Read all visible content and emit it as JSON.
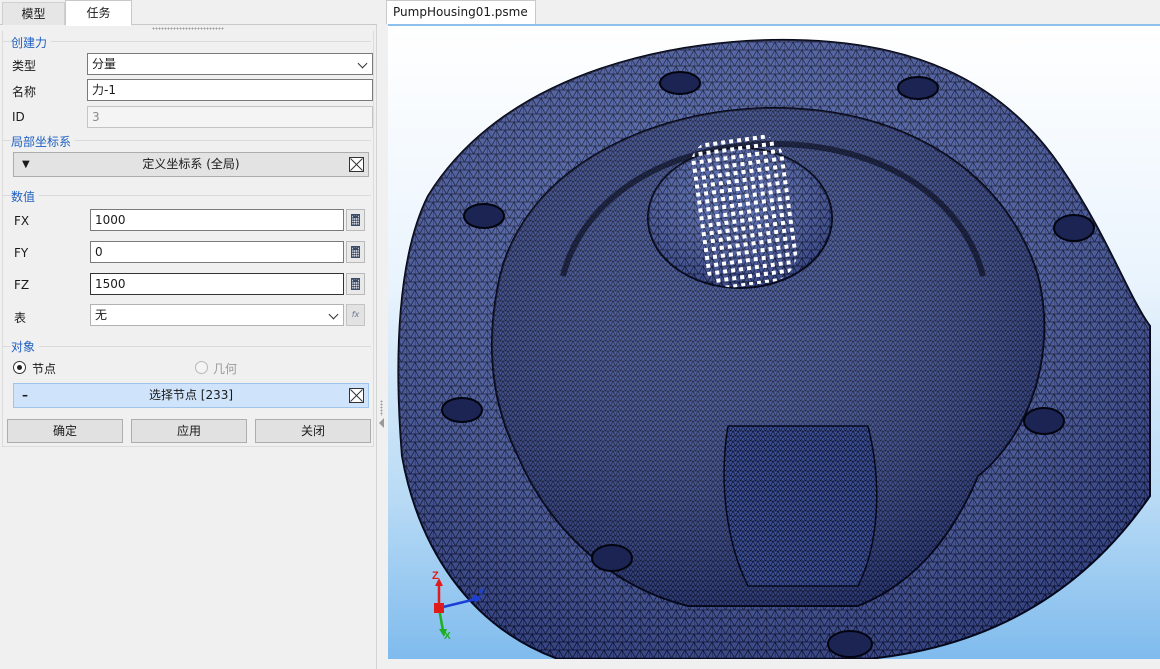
{
  "left_panel": {
    "tabs": [
      {
        "label": "模型",
        "active": false
      },
      {
        "label": "任务",
        "active": true
      }
    ],
    "create_force": {
      "title": "创建力",
      "type_label": "类型",
      "type_value": "分量",
      "name_label": "名称",
      "name_value": "力-1",
      "id_label": "ID",
      "id_value": "3"
    },
    "local_csys": {
      "title": "局部坐标系",
      "bar_label": "定义坐标系 (全局)"
    },
    "values": {
      "title": "数值",
      "fx_label": "FX",
      "fx_value": "1000",
      "fy_label": "FY",
      "fy_value": "0",
      "fz_label": "FZ",
      "fz_value": "1500",
      "table_label": "表",
      "table_value": "无",
      "fx_button_glyph": "fx"
    },
    "target": {
      "title": "对象",
      "option_nodes": "节点",
      "option_geometry": "几何",
      "selected_option": "节点",
      "select_bar_label": "选择节点 [233]"
    },
    "buttons": {
      "ok": "确定",
      "apply": "应用",
      "close": "关闭"
    }
  },
  "document": {
    "tab_title": "PumpHousing01.psme *",
    "triad_labels": {
      "z": "Z",
      "y": "Y",
      "x": "X"
    },
    "colors": {
      "mesh_fill": "#4a5fa8",
      "mesh_lines": "#0a0f2a",
      "node_markers": "#ffffff",
      "background_top": "#ffffff",
      "background_bottom": "#7fbbed",
      "triad_x": "#1fae1f",
      "triad_y": "#1c3fd6",
      "triad_z": "#e01b1b"
    }
  }
}
